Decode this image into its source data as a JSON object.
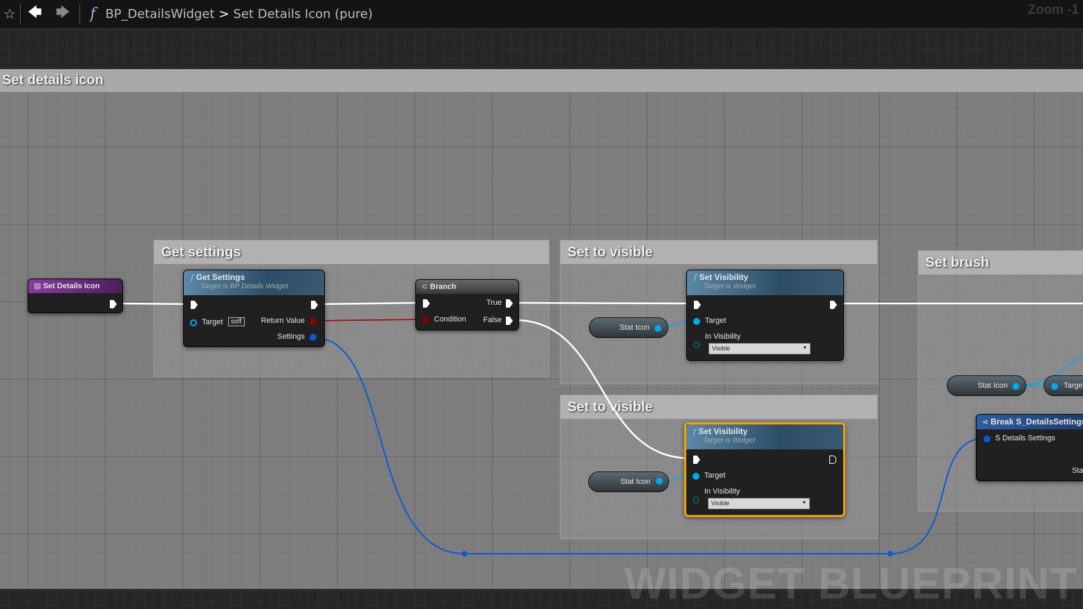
{
  "toolbar": {
    "breadcrumb_root": "BP_DetailsWidget",
    "breadcrumb_sep": ">",
    "breadcrumb_current": "Set Details Icon (pure)",
    "zoom": "Zoom -1"
  },
  "comments": {
    "main": "Set details icon",
    "get_settings": "Get settings",
    "visible1": "Set to visible",
    "visible2": "Set to visible",
    "brush": "Set brush"
  },
  "nodes": {
    "entry": {
      "title": "Set Details Icon"
    },
    "get_settings": {
      "title": "Get Settings",
      "subtitle": "Target is BP Details Widget",
      "target": "Target",
      "self": "self",
      "return": "Return Value",
      "settings": "Settings"
    },
    "branch": {
      "title": "Branch",
      "condition": "Condition",
      "true": "True",
      "false": "False"
    },
    "set_vis1": {
      "title": "Set Visibility",
      "subtitle": "Target is Widget",
      "target": "Target",
      "in_vis": "In Visibility",
      "value": "Visible"
    },
    "set_vis2": {
      "title": "Set Visibility",
      "subtitle": "Target is Widget",
      "target": "Target",
      "in_vis": "In Visibility",
      "value": "Visible"
    },
    "stat_icon1": "Stat Icon",
    "stat_icon2": "Stat Icon",
    "stat_icon3": "Stat Icon",
    "target_pill": "Target",
    "break": {
      "title": "Break S_DetailsSettings",
      "in": "S Details Settings",
      "out": "Sta"
    }
  },
  "watermark": "WIDGET BLUEPRINT",
  "colors": {
    "exec": "#ffffff",
    "bool": "#8c0000",
    "object": "#00a8f0",
    "struct": "#0a5ad8",
    "selected": "#f3a200"
  }
}
